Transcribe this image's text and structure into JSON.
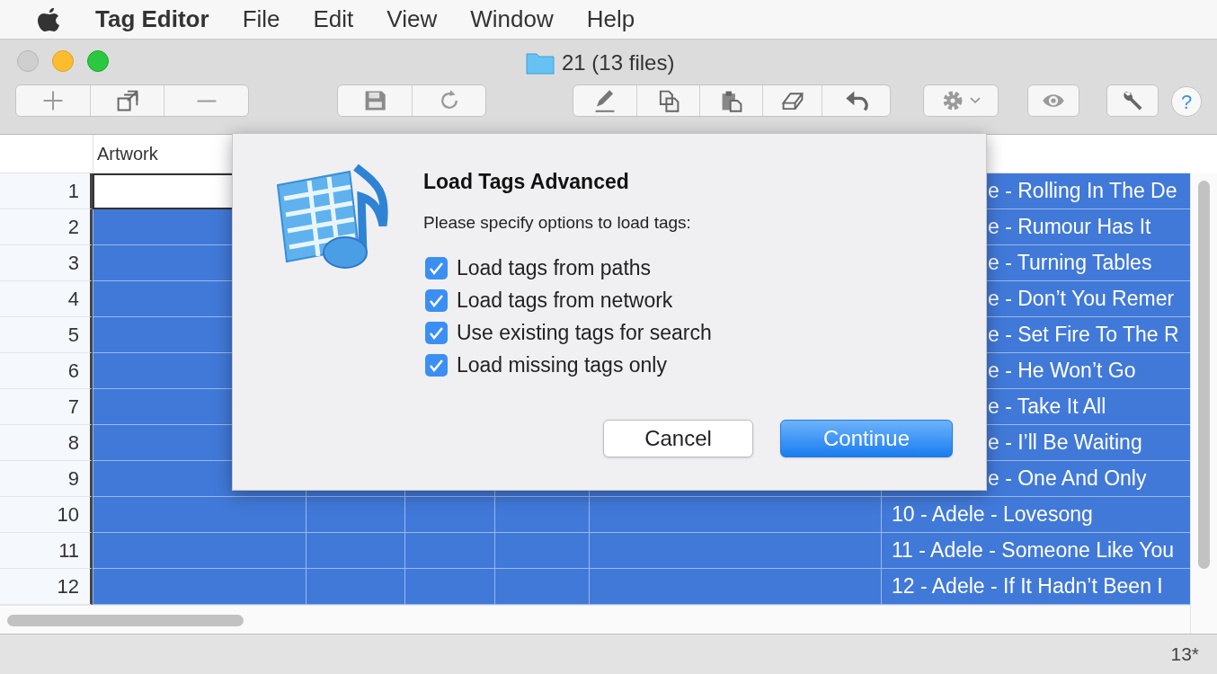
{
  "menu_bar": {
    "app_name": "Tag Editor",
    "items": [
      "File",
      "Edit",
      "View",
      "Window",
      "Help"
    ]
  },
  "window": {
    "title": "21 (13 files)"
  },
  "toolbar": {
    "help_label": "?"
  },
  "table": {
    "columns": [
      {
        "label": "Artwork"
      }
    ],
    "rows": [
      {
        "number": "1",
        "selected": true,
        "filename": "e - Rolling In The De"
      },
      {
        "number": "2",
        "selected": true,
        "filename": "e - Rumour Has It"
      },
      {
        "number": "3",
        "selected": true,
        "filename": "e - Turning Tables"
      },
      {
        "number": "4",
        "selected": true,
        "filename": "e - Don’t You Remer"
      },
      {
        "number": "5",
        "selected": true,
        "filename": "e - Set Fire To The R"
      },
      {
        "number": "6",
        "selected": true,
        "filename": "e - He Won’t Go"
      },
      {
        "number": "7",
        "selected": true,
        "filename": "e - Take It All"
      },
      {
        "number": "8",
        "selected": true,
        "filename": "e - I’ll Be Waiting"
      },
      {
        "number": "9",
        "selected": true,
        "filename": "e - One And Only"
      },
      {
        "number": "10",
        "selected": true,
        "filename": "10 - Adele - Lovesong"
      },
      {
        "number": "11",
        "selected": true,
        "filename": "11 - Adele - Someone Like You"
      },
      {
        "number": "12",
        "selected": true,
        "filename": "12 - Adele - If It Hadn’t Been I"
      }
    ]
  },
  "dialog": {
    "title": "Load Tags Advanced",
    "message": "Please specify options to load tags:",
    "options": [
      {
        "label": "Load tags from paths",
        "checked": true
      },
      {
        "label": "Load tags from network",
        "checked": true
      },
      {
        "label": "Use existing tags for search",
        "checked": true
      },
      {
        "label": "Load missing tags only",
        "checked": true
      }
    ],
    "buttons": [
      {
        "label": "Cancel",
        "kind": "secondary"
      },
      {
        "label": "Continue",
        "kind": "primary"
      }
    ]
  },
  "status_bar": {
    "count": "13*"
  }
}
